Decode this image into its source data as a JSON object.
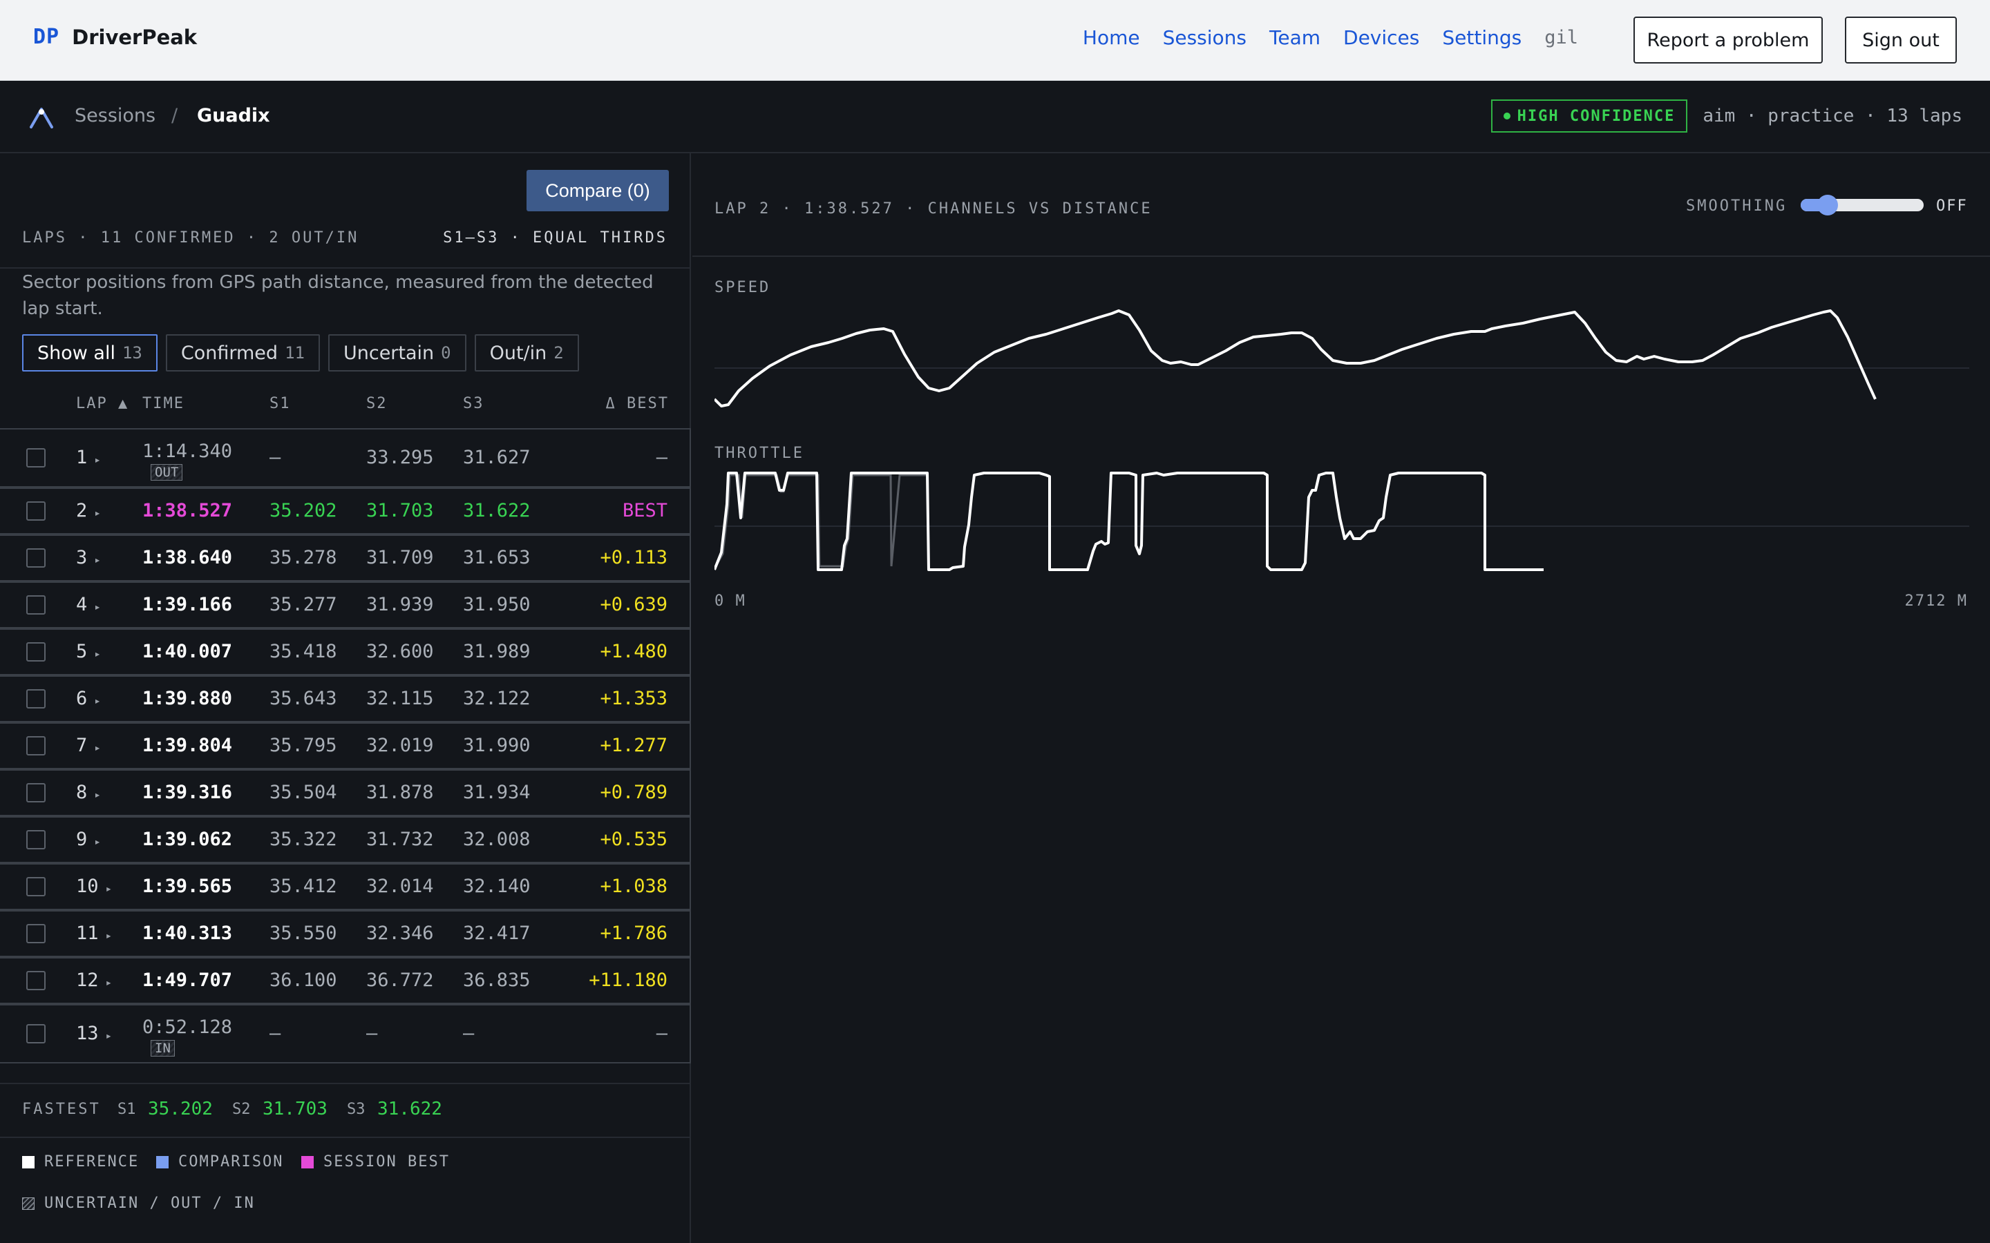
{
  "brand": {
    "mark": "DP",
    "name": "DriverPeak"
  },
  "nav": {
    "links": [
      "Home",
      "Sessions",
      "Team",
      "Devices",
      "Settings"
    ],
    "user": "gil",
    "report_label": "Report a problem",
    "signout_label": "Sign out"
  },
  "breadcrumb": {
    "parent": "Sessions",
    "separator": "/",
    "current": "Guadix"
  },
  "confidence": "HIGH CONFIDENCE",
  "session_meta": "aim · practice · 13 laps",
  "laps_panel": {
    "compare_label": "Compare (0)",
    "summary": "LAPS · 11 CONFIRMED · 2 OUT/IN",
    "sector_mode": "S1–S3 · EQUAL THIRDS",
    "note": "Sector positions from GPS path distance, measured from the detected lap start.",
    "filters": [
      {
        "label": "Show all",
        "count": "13"
      },
      {
        "label": "Confirmed",
        "count": "11"
      },
      {
        "label": "Uncertain",
        "count": "0"
      },
      {
        "label": "Out/in",
        "count": "2"
      }
    ],
    "headers": {
      "lap": "LAP ▲",
      "time": "TIME",
      "s1": "S1",
      "s2": "S2",
      "s3": "S3",
      "delta": "Δ BEST"
    },
    "rows": [
      {
        "lap": "1",
        "time": "1:14.340",
        "s1": "—",
        "s2": "33.295",
        "s3": "31.627",
        "delta": "—",
        "tag": "OUT"
      },
      {
        "lap": "2",
        "time": "1:38.527",
        "s1": "35.202",
        "s2": "31.703",
        "s3": "31.622",
        "delta": "BEST"
      },
      {
        "lap": "3",
        "time": "1:38.640",
        "s1": "35.278",
        "s2": "31.709",
        "s3": "31.653",
        "delta": "+0.113"
      },
      {
        "lap": "4",
        "time": "1:39.166",
        "s1": "35.277",
        "s2": "31.939",
        "s3": "31.950",
        "delta": "+0.639"
      },
      {
        "lap": "5",
        "time": "1:40.007",
        "s1": "35.418",
        "s2": "32.600",
        "s3": "31.989",
        "delta": "+1.480"
      },
      {
        "lap": "6",
        "time": "1:39.880",
        "s1": "35.643",
        "s2": "32.115",
        "s3": "32.122",
        "delta": "+1.353"
      },
      {
        "lap": "7",
        "time": "1:39.804",
        "s1": "35.795",
        "s2": "32.019",
        "s3": "31.990",
        "delta": "+1.277"
      },
      {
        "lap": "8",
        "time": "1:39.316",
        "s1": "35.504",
        "s2": "31.878",
        "s3": "31.934",
        "delta": "+0.789"
      },
      {
        "lap": "9",
        "time": "1:39.062",
        "s1": "35.322",
        "s2": "31.732",
        "s3": "32.008",
        "delta": "+0.535"
      },
      {
        "lap": "10",
        "time": "1:39.565",
        "s1": "35.412",
        "s2": "32.014",
        "s3": "32.140",
        "delta": "+1.038"
      },
      {
        "lap": "11",
        "time": "1:40.313",
        "s1": "35.550",
        "s2": "32.346",
        "s3": "32.417",
        "delta": "+1.786"
      },
      {
        "lap": "12",
        "time": "1:49.707",
        "s1": "36.100",
        "s2": "36.772",
        "s3": "36.835",
        "delta": "+11.180"
      },
      {
        "lap": "13",
        "time": "0:52.128",
        "s1": "—",
        "s2": "—",
        "s3": "—",
        "delta": "—",
        "tag": "IN"
      }
    ],
    "fastest": {
      "label": "FASTEST",
      "s1_label": "S1",
      "s1": "35.202",
      "s2_label": "S2",
      "s2": "31.703",
      "s3_label": "S3",
      "s3": "31.622"
    },
    "legend": [
      {
        "label": "REFERENCE",
        "color": "#ffffff"
      },
      {
        "label": "COMPARISON",
        "color": "#7a9ef0"
      },
      {
        "label": "SESSION BEST",
        "color": "#e54ad8"
      },
      {
        "label": "UNCERTAIN / OUT / IN",
        "color": "hatched"
      }
    ]
  },
  "channels": {
    "title": "LAP 2 · 1:38.527 · CHANNELS VS DISTANCE",
    "smoothing_label": "SMOOTHING",
    "smoothing_value": "OFF",
    "smoothing_level": 0.1,
    "speed_label": "SPEED",
    "throttle_label": "THROTTLE",
    "x_start": "0 M",
    "x_end": "2712 M"
  },
  "colors": {
    "accent": "#1a56d6",
    "best": "#e54ad8",
    "fast": "#39d353",
    "delta": "#f0e020",
    "confidence": "#39d353"
  }
}
